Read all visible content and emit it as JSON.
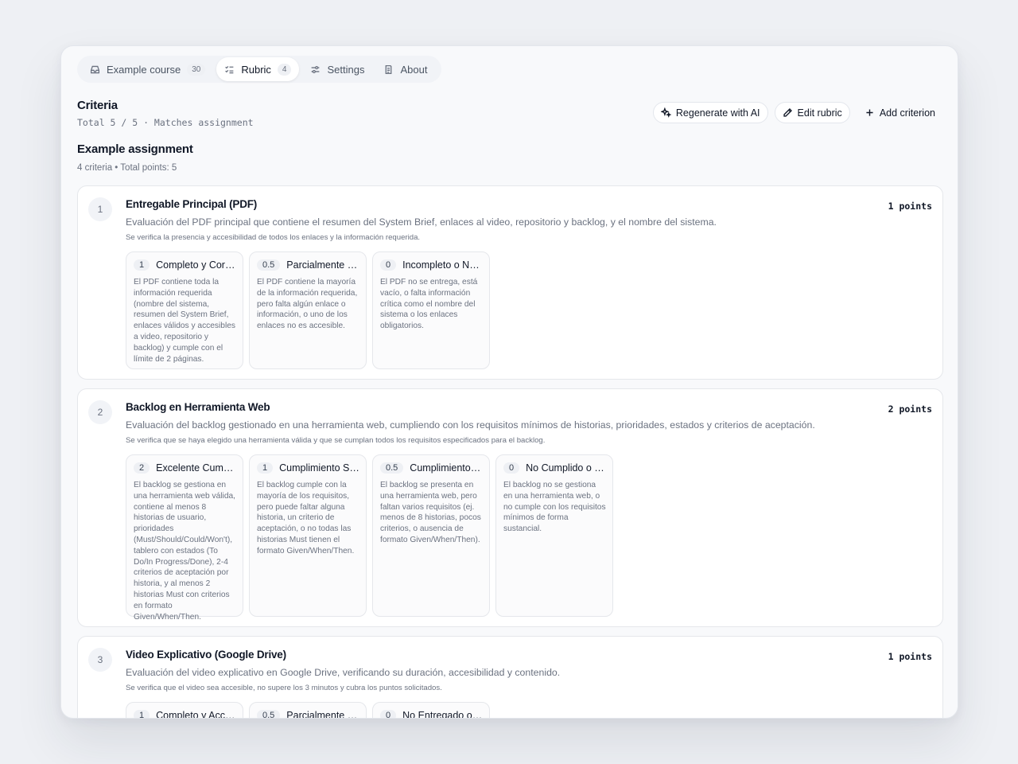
{
  "tabs": [
    {
      "label": "Example course",
      "badge": "30",
      "icon": "inbox-icon"
    },
    {
      "label": "Rubric",
      "badge": "4",
      "icon": "checklist-icon"
    },
    {
      "label": "Settings",
      "badge": "",
      "icon": "sliders-icon"
    },
    {
      "label": "About",
      "badge": "",
      "icon": "document-icon"
    }
  ],
  "header": {
    "title": "Criteria",
    "subtitle": "Total 5 / 5 · Matches assignment"
  },
  "actions": {
    "regenerate": "Regenerate with AI",
    "edit": "Edit rubric",
    "add": "Add criterion"
  },
  "assignment": {
    "title": "Example assignment",
    "summary": "4 criteria • Total points: 5"
  },
  "criteria": [
    {
      "number": "1",
      "title": "Entregable Principal (PDF)",
      "points": "1 points",
      "description": "Evaluación del PDF principal que contiene el resumen del System Brief, enlaces al video, repositorio y backlog, y el nombre del sistema.",
      "note": "Se verifica la presencia y accesibilidad de todos los enlaces y la información requerida.",
      "levels": [
        {
          "score": "1",
          "name": "Completo y Correcto",
          "text": "El PDF contiene toda la información requerida (nombre del sistema, resumen del System Brief, enlaces válidos y accesibles a video, repositorio y backlog) y cumple con el límite de 2 páginas."
        },
        {
          "score": "0.5",
          "name": "Parcialmente Completo",
          "text": "El PDF contiene la mayoría de la información requerida, pero falta algún enlace o información, o uno de los enlaces no es accesible."
        },
        {
          "score": "0",
          "name": "Incompleto o No Entregado",
          "text": "El PDF no se entrega, está vacío, o falta información crítica como el nombre del sistema o los enlaces obligatorios."
        }
      ]
    },
    {
      "number": "2",
      "title": "Backlog en Herramienta Web",
      "points": "2 points",
      "description": "Evaluación del backlog gestionado en una herramienta web, cumpliendo con los requisitos mínimos de historias, prioridades, estados y criterios de aceptación.",
      "note": "Se verifica que se haya elegido una herramienta válida y que se cumplan todos los requisitos especificados para el backlog.",
      "levels": [
        {
          "score": "2",
          "name": "Excelente Cumplimiento",
          "text": "El backlog se gestiona en una herramienta web válida, contiene al menos 8 historias de usuario, prioridades (Must/Should/Could/Won't), tablero con estados (To Do/In Progress/Done), 2-4 criterios de aceptación por historia, y al menos 2 historias Must con criterios en formato Given/When/Then."
        },
        {
          "score": "1",
          "name": "Cumplimiento Suficiente",
          "text": "El backlog cumple con la mayoría de los requisitos, pero puede faltar alguna historia, un criterio de aceptación, o no todas las historias Must tienen el formato Given/When/Then."
        },
        {
          "score": "0.5",
          "name": "Cumplimiento Parcial",
          "text": "El backlog se presenta en una herramienta web, pero faltan varios requisitos (ej. menos de 8 historias, pocos criterios, o ausencia de formato Given/When/Then)."
        },
        {
          "score": "0",
          "name": "No Cumplido o No Entregado",
          "text": "El backlog no se gestiona en una herramienta web, o no cumple con los requisitos mínimos de forma sustancial."
        }
      ]
    },
    {
      "number": "3",
      "title": "Video Explicativo (Google Drive)",
      "points": "1 points",
      "description": "Evaluación del video explicativo en Google Drive, verificando su duración, accesibilidad y contenido.",
      "note": "Se verifica que el video sea accesible, no supere los 3 minutos y cubra los puntos solicitados.",
      "levels": [
        {
          "score": "1",
          "name": "Completo y Accesible",
          "text": ""
        },
        {
          "score": "0.5",
          "name": "Parcialmente Completo",
          "text": ""
        },
        {
          "score": "0",
          "name": "No Entregado o No Accesible",
          "text": ""
        }
      ]
    }
  ]
}
